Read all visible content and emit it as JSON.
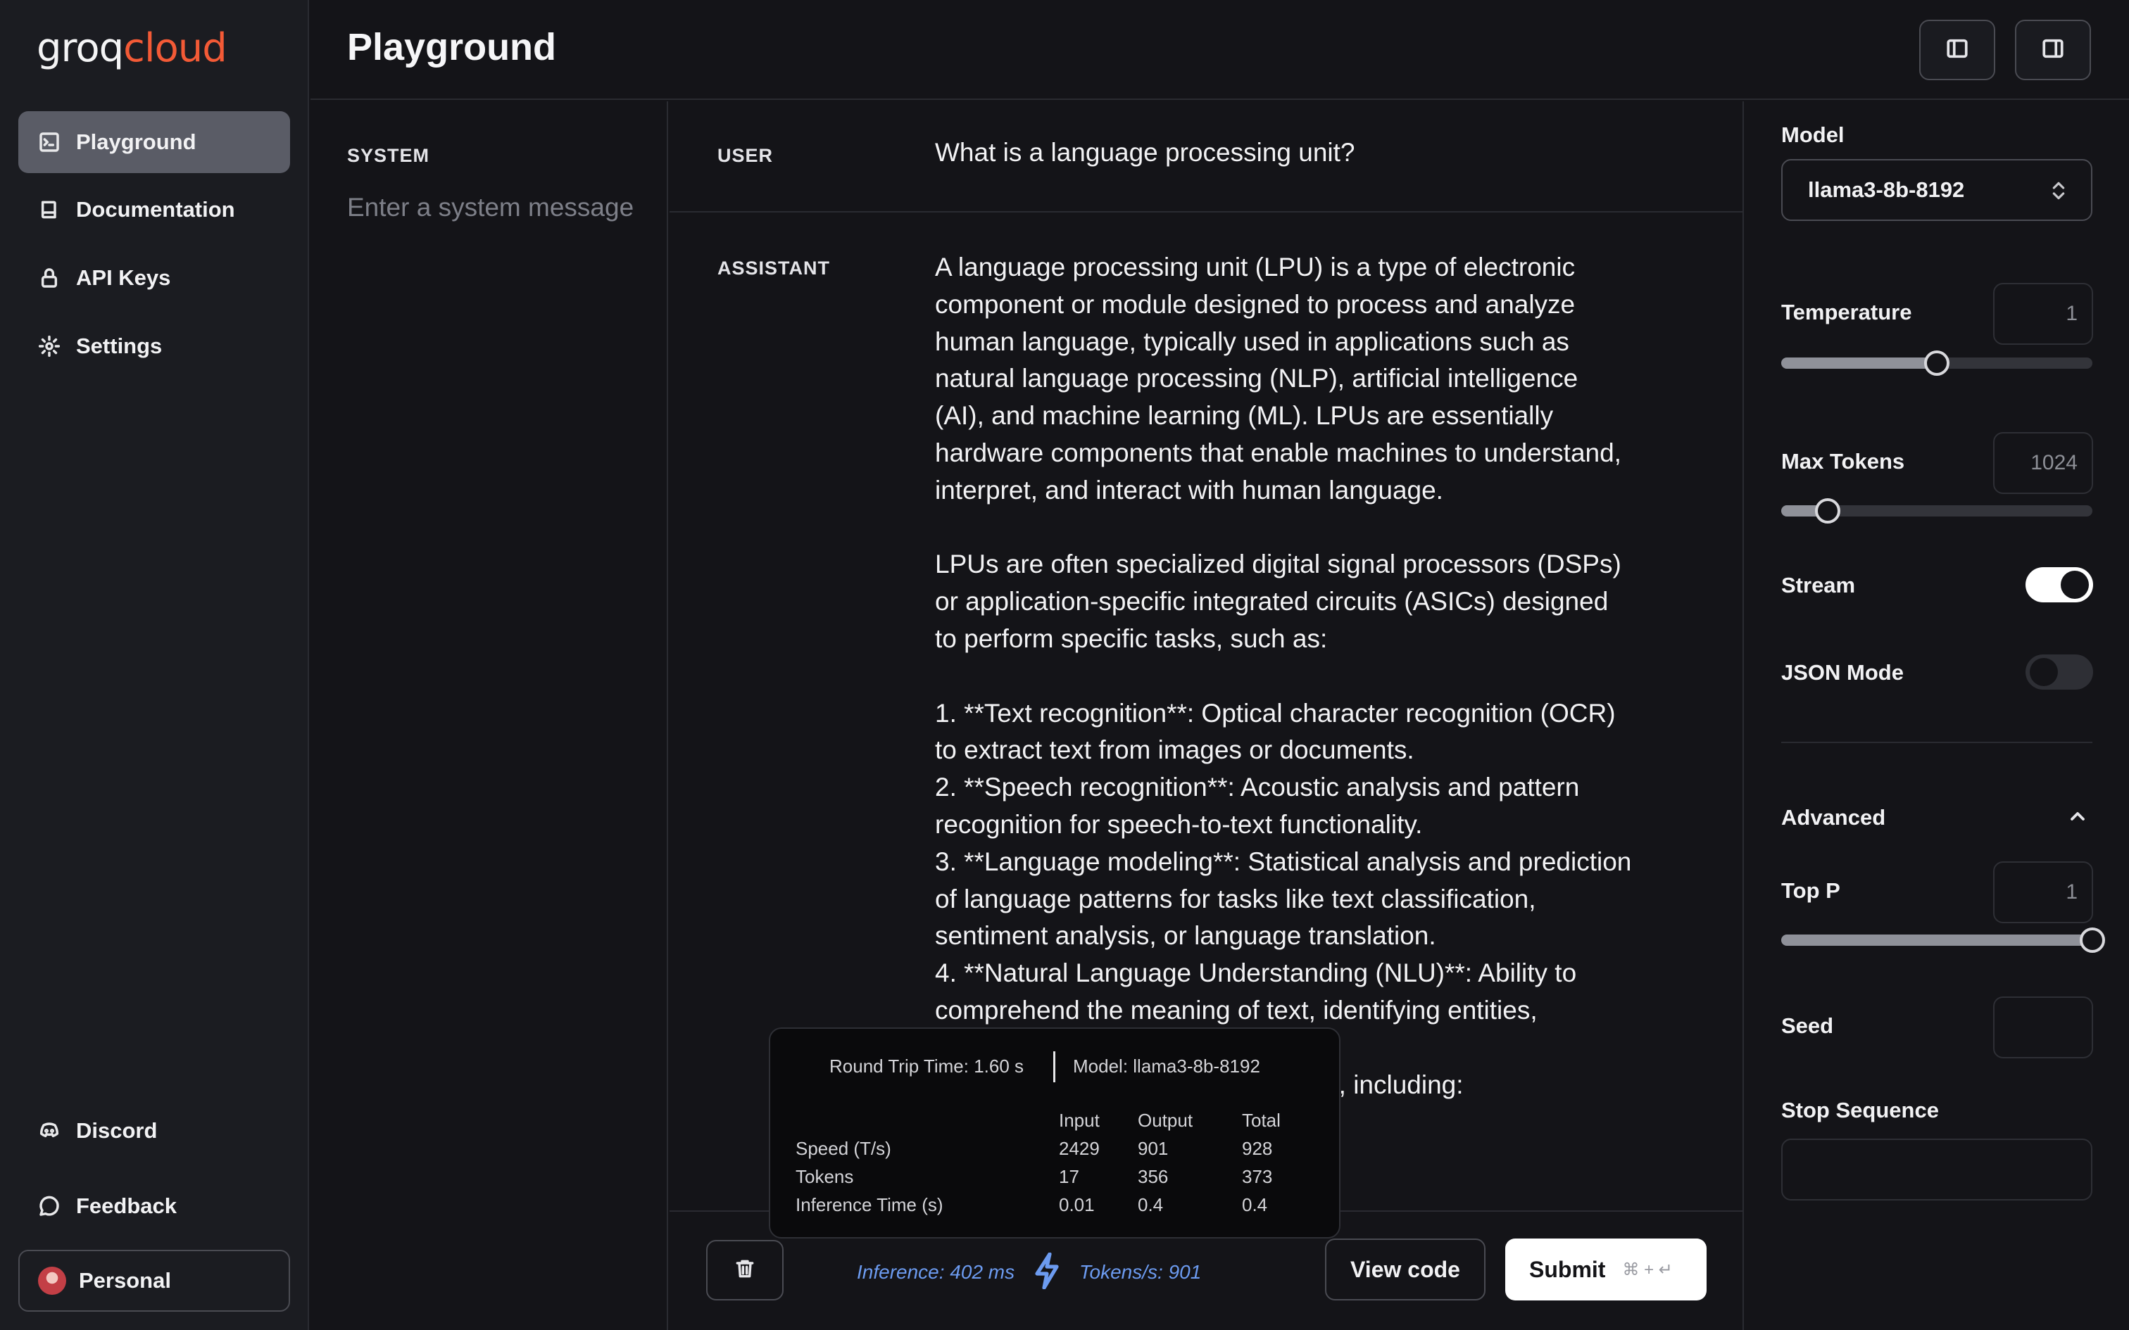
{
  "brand": {
    "logo_part1": "groq",
    "logo_part2": "cloud",
    "accent_color": "#f35a36"
  },
  "nav": {
    "items": [
      {
        "label": "Playground",
        "icon": "terminal-icon",
        "active": true
      },
      {
        "label": "Documentation",
        "icon": "book-icon"
      },
      {
        "label": "API Keys",
        "icon": "lock-icon"
      },
      {
        "label": "Settings",
        "icon": "gear-icon"
      }
    ],
    "bottom": [
      {
        "label": "Discord",
        "icon": "discord-icon"
      },
      {
        "label": "Feedback",
        "icon": "message-circle-icon"
      },
      {
        "label": "Personal",
        "icon": "avatar"
      }
    ]
  },
  "header": {
    "title": "Playground",
    "left_toggle_icon": "sidebar-left-icon",
    "right_toggle_icon": "sidebar-right-icon"
  },
  "system": {
    "label": "SYSTEM",
    "placeholder": "Enter a system message"
  },
  "chat": {
    "user_label": "USER",
    "user_message": "What is a language processing unit?",
    "assistant_label": "ASSISTANT",
    "assistant_message": "A language processing unit (LPU) is a type of electronic component or module designed to process and analyze human language, typically used in applications such as natural language processing (NLP), artificial intelligence (AI), and machine learning (ML). LPUs are essentially hardware components that enable machines to understand, interpret, and interact with human language.\n\nLPUs are often specialized digital signal processors (DSPs) or application-specific integrated circuits (ASICs) designed to perform specific tasks, such as:\n\n1. **Text recognition**: Optical character recognition (OCR) to extract text from images or documents.\n2. **Speech recognition**: Acoustic analysis and pattern recognition for speech-to-text functionality.\n3. **Language modeling**: Statistical analysis and prediction of language patterns for tasks like text classification, sentiment analysis, or language translation.\n4. **Natural Language Understanding (NLU)**: Ability to comprehend the meaning of text, identifying entities,\n\n                                                  ons, including:"
  },
  "stats": {
    "round_trip": "Round Trip Time: 1.60 s",
    "model": "Model: llama3-8b-8192",
    "columns": [
      "Input",
      "Output",
      "Total"
    ],
    "rows": [
      {
        "label": "Speed (T/s)",
        "values": [
          "2429",
          "901",
          "928"
        ]
      },
      {
        "label": "Tokens",
        "values": [
          "17",
          "356",
          "373"
        ]
      },
      {
        "label": "Inference Time (s)",
        "values": [
          "0.01",
          "0.4",
          "0.4"
        ]
      }
    ]
  },
  "footer": {
    "inference": "Inference: 402 ms",
    "tokens_per_s": "Tokens/s: 901",
    "view_code": "View code",
    "submit": "Submit",
    "submit_shortcut": "⌘ + ↵"
  },
  "settings": {
    "model_label": "Model",
    "model_value": "llama3-8b-8192",
    "temperature_label": "Temperature",
    "temperature_value": "1",
    "temperature_fraction": 0.5,
    "max_tokens_label": "Max Tokens",
    "max_tokens_value": "1024",
    "max_tokens_fraction": 0.15,
    "stream_label": "Stream",
    "stream_on": true,
    "json_mode_label": "JSON Mode",
    "json_mode_on": false,
    "advanced_label": "Advanced",
    "top_p_label": "Top P",
    "top_p_value": "1",
    "top_p_fraction": 1.0,
    "seed_label": "Seed",
    "seed_value": "",
    "stop_sequence_label": "Stop Sequence"
  }
}
